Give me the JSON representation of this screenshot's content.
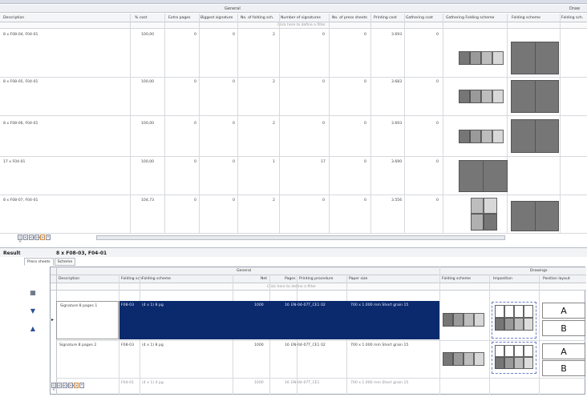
{
  "top_table": {
    "group_header": "General",
    "group_header_right": "Draw",
    "columns": [
      "Description",
      "% cost",
      "Extra pages",
      "Biggest signature",
      "No. of folding sch.",
      "Number of signatures",
      "No. of press sheets",
      "Printing cost",
      "Gathering cost",
      "Gathering Folding scheme",
      "Folding scheme",
      "Folding sch."
    ],
    "filter_placeholder": "Click here to define a filter",
    "rows": [
      {
        "description": "8 x F08-04, F04-01",
        "cost": "100,00",
        "extra": "0",
        "biggest": "0",
        "folding": "2",
        "signatures": "0",
        "press": "0",
        "printing": "3.693",
        "gathering": "0"
      },
      {
        "description": "8 x F08-05, F04-01",
        "cost": "100,00",
        "extra": "0",
        "biggest": "0",
        "folding": "2",
        "signatures": "0",
        "press": "0",
        "printing": "3.683",
        "gathering": "0"
      },
      {
        "description": "8 x F08-06, F04-01",
        "cost": "100,00",
        "extra": "0",
        "biggest": "0",
        "folding": "2",
        "signatures": "0",
        "press": "0",
        "printing": "3.693",
        "gathering": "0"
      },
      {
        "description": "17 x F04-01",
        "cost": "100,00",
        "extra": "0",
        "biggest": "0",
        "folding": "1",
        "signatures": "17",
        "press": "0",
        "printing": "3.690",
        "gathering": "0"
      },
      {
        "description": "8 x F08-07, F04-01",
        "cost": "104,73",
        "extra": "0",
        "biggest": "0",
        "folding": "2",
        "signatures": "0",
        "press": "0",
        "printing": "3.556",
        "gathering": "0"
      }
    ]
  },
  "result": {
    "label": "Result",
    "value": "8 x F08-03, F04-01",
    "tabs": [
      "Press sheets",
      "Scheme"
    ]
  },
  "lower_table": {
    "group_general": "General",
    "group_drawings": "Drawings",
    "columns": [
      "Description",
      "Folding sch.",
      "Folding scheme",
      "Net",
      "Pages",
      "Printing procedure",
      "Paper size",
      "Folding scheme",
      "Imposition",
      "Position layout"
    ],
    "filter_placeholder": "Click here to define a filter",
    "rows": [
      {
        "description": "Signature 8 pages 1",
        "folding_sch": "F08-03",
        "folding_scheme": "(4 x 1) 8 pg",
        "net": "1000",
        "pages": "16",
        "procedure": "EN-04-07T_CE1 02",
        "paper": "700 x 1.000 mm Short grain 15"
      },
      {
        "description": "Signature 8 pages 2",
        "folding_sch": "F08-03",
        "folding_scheme": "(4 x 1) 8 pg",
        "net": "1000",
        "pages": "16",
        "procedure": "EN-04-07T_CE1 02",
        "paper": "700 x 1.000 mm Short grain 15"
      },
      {
        "description": "",
        "folding_sch": "F04-01",
        "folding_scheme": "(4 x 1) 4 pg",
        "net": "1000",
        "pages": "16",
        "procedure": "EN-04-07T_CE1",
        "paper": "700 x 1.000 mm Short grain 15"
      }
    ],
    "letters": [
      "A",
      "B",
      "A",
      "B"
    ]
  },
  "nav_glyphs": [
    "|<",
    "<",
    "<<",
    ">>",
    ">",
    "*"
  ]
}
